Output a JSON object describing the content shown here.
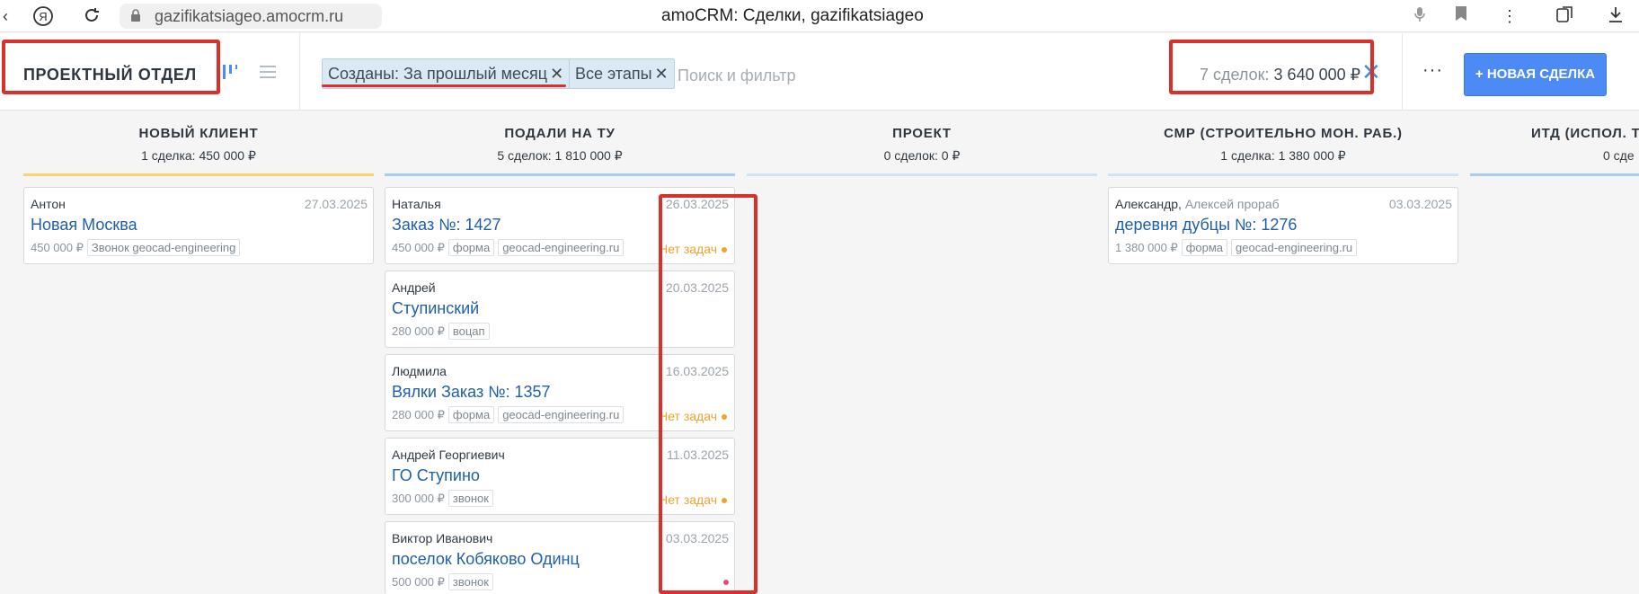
{
  "browser": {
    "url": "gazifikatsiageo.amocrm.ru",
    "page_title": "amoCRM: Сделки, gazifikatsiageo"
  },
  "header": {
    "department": "ПРОЕКТНЫЙ ОТДЕЛ",
    "filter_created": "Созданы: За прошлый месяц",
    "filter_stages": "Все этапы",
    "search_placeholder": "Поиск и фильтр",
    "summary_count": "7 сделок:",
    "summary_amount": "3 640 000 ₽",
    "more_label": "···",
    "new_deal_label": "+ НОВАЯ СДЕЛКА"
  },
  "columns": [
    {
      "name": "НОВЫЙ КЛИЕНТ",
      "summary": "1 сделка: 450 000 ₽",
      "color": "#fbd46b"
    },
    {
      "name": "ПОДАЛИ НА ТУ",
      "summary": "5 сделок: 1 810 000 ₽",
      "color": "#a8cdf2"
    },
    {
      "name": "ПРОЕКТ",
      "summary": "0 сделок: 0 ₽",
      "color": "#cfe3f7"
    },
    {
      "name": "СМР (СТРОИТЕЛЬНО МОН. РАБ.)",
      "summary": "1 сделка: 1 380 000 ₽",
      "color": "#cfe3f7"
    },
    {
      "name": "ИТД (ИСПОЛ. Т",
      "summary": "0 сде",
      "color": "#a8cdf2"
    }
  ],
  "cards": {
    "c1": {
      "contact": "Антон",
      "date": "27.03.2025",
      "title": "Новая Москва",
      "price": "450 000 ₽",
      "tag1": "Звонок geocad-engineering"
    },
    "c2": {
      "contact": "Наталья",
      "date": "26.03.2025",
      "title": "Заказ №: 1427",
      "price": "450 000 ₽",
      "tag1": "форма",
      "tag2": "geocad-engineering.ru",
      "status": "Нет задач"
    },
    "c3": {
      "contact": "Андрей",
      "date": "20.03.2025",
      "title": "Ступинский",
      "price": "280 000 ₽",
      "tag1": "воцап"
    },
    "c4": {
      "contact": "Людмила",
      "date": "16.03.2025",
      "title": "Вялки Заказ №: 1357",
      "price": "280 000 ₽",
      "tag1": "форма",
      "tag2": "geocad-engineering.ru",
      "status": "Нет задач"
    },
    "c5": {
      "contact": "Андрей Георгиевич",
      "date": "11.03.2025",
      "title": "ГО Ступино",
      "price": "300 000 ₽",
      "tag1": "звонок",
      "status": "Нет задач"
    },
    "c6": {
      "contact": "Виктор Иванович",
      "date": "03.03.2025",
      "title": "поселок Кобяково Одинц",
      "price": "500 000 ₽",
      "tag1": "звонок"
    },
    "c7": {
      "contact": "Александр,",
      "contact_extra": "Алексей прораб",
      "date": "03.03.2025",
      "title": "деревня дубцы №: 1276",
      "price": "1 380 000 ₽",
      "tag1": "форма",
      "tag2": "geocad-engineering.ru"
    }
  },
  "colors": {
    "accent": "#4c8bf5",
    "link": "#1f5fa8",
    "warning": "#f2a22e",
    "highlight": "#d9302c",
    "pink_dot": "#e8467c"
  }
}
